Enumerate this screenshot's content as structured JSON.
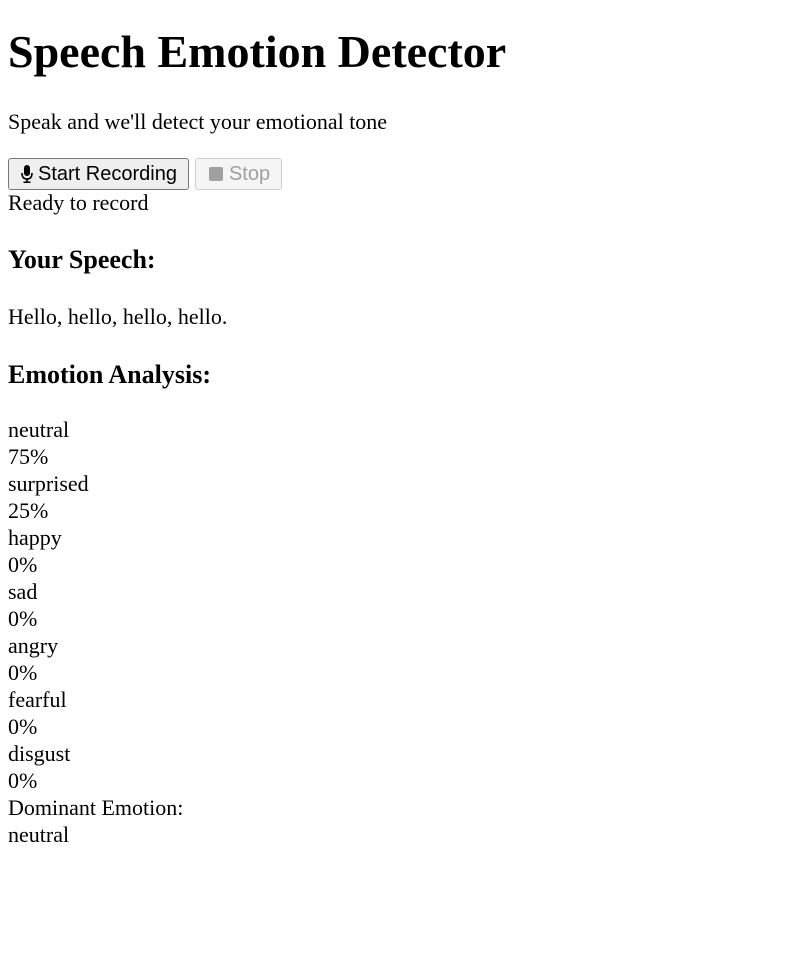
{
  "header": {
    "title": "Speech Emotion Detector",
    "subtitle": "Speak and we'll detect your emotional tone"
  },
  "controls": {
    "start_label": "Start Recording",
    "start_icon": "microphone-icon",
    "stop_label": "Stop",
    "stop_icon": "stop-square-icon",
    "stop_disabled": true
  },
  "status": "Ready to record",
  "speech": {
    "heading": "Your Speech:",
    "transcript": "Hello, hello, hello, hello."
  },
  "analysis": {
    "heading": "Emotion Analysis:",
    "emotions": [
      {
        "label": "neutral",
        "percent": "75%"
      },
      {
        "label": "surprised",
        "percent": "25%"
      },
      {
        "label": "happy",
        "percent": "0%"
      },
      {
        "label": "sad",
        "percent": "0%"
      },
      {
        "label": "angry",
        "percent": "0%"
      },
      {
        "label": "fearful",
        "percent": "0%"
      },
      {
        "label": "disgust",
        "percent": "0%"
      }
    ],
    "dominant_label": "Dominant Emotion:",
    "dominant_value": "neutral"
  }
}
